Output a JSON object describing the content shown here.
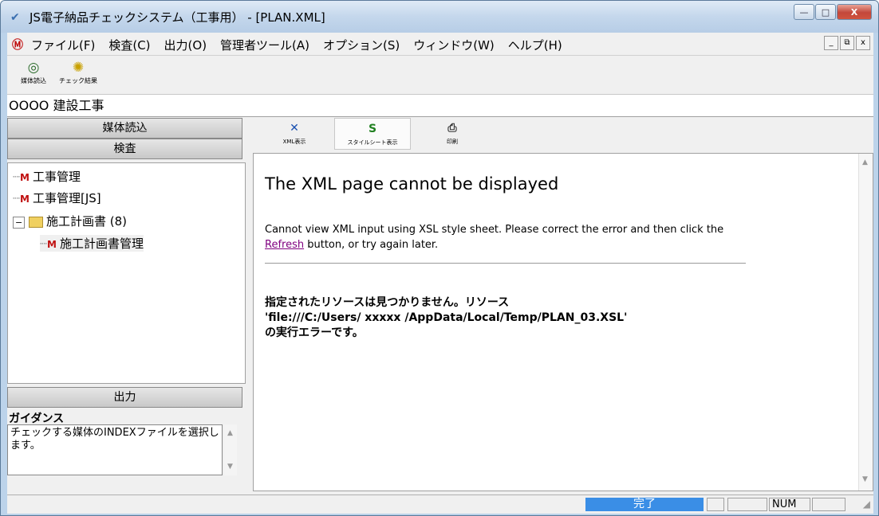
{
  "window": {
    "title": "JS電子納品チェックシステム（工事用） - [PLAN.XML]",
    "min_glyph": "—",
    "max_glyph": "□",
    "close_glyph": "X"
  },
  "menubar": {
    "items": [
      "ファイル(F)",
      "検査(C)",
      "出力(O)",
      "管理者ツール(A)",
      "オプション(S)",
      "ウィンドウ(W)",
      "ヘルプ(H)"
    ],
    "mdi_buttons": [
      "_",
      "⧉",
      "x"
    ]
  },
  "toolbar": {
    "read_media_label": "媒体読込",
    "check_result_label": "チェック結果"
  },
  "project_name": "OOOO 建設工事",
  "left_panel": {
    "read_media": "媒体読込",
    "inspect": "検査",
    "output": "出力",
    "tree": [
      "工事管理",
      "工事管理[JS]",
      "施工計画書 (8)",
      "施工計画書管理"
    ],
    "guidance_title": "ガイダンス",
    "guidance_text": "チェックする媒体のINDEXファイルを選択します。"
  },
  "view_toolbar": {
    "xml_label": "XML表示",
    "stylesheet_label": "スタイルシート表示",
    "print_label": "印刷"
  },
  "error_page": {
    "title": "The XML page cannot be displayed",
    "message_before": "Cannot view XML input using XSL style sheet. Please correct the error and then click the ",
    "refresh_link": "Refresh",
    "message_after": " button, or try again later.",
    "detail_line1": "指定されたリソースは見つかりません。リソース",
    "detail_line2": "'file:///C:/Users/ xxxxx /AppData/Local/Temp/PLAN_03.XSL'",
    "detail_line3": "の実行エラーです。"
  },
  "statusbar": {
    "progress_text": "完了",
    "num_indicator": "NUM"
  },
  "colors": {
    "accent": "#3a8ee6",
    "close_button": "#c3473a",
    "link_visited": "#800080"
  }
}
